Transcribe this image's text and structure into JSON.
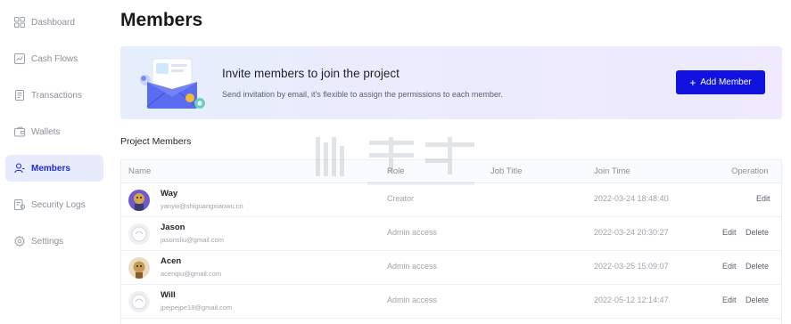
{
  "sidebar": {
    "items": [
      {
        "label": "Dashboard",
        "icon": "dashboard-icon"
      },
      {
        "label": "Cash Flows",
        "icon": "chart-icon"
      },
      {
        "label": "Transactions",
        "icon": "document-icon"
      },
      {
        "label": "Wallets",
        "icon": "wallet-icon"
      },
      {
        "label": "Members",
        "icon": "user-icon",
        "active": true
      },
      {
        "label": "Security Logs",
        "icon": "security-log-icon"
      },
      {
        "label": "Settings",
        "icon": "gear-icon"
      }
    ]
  },
  "page": {
    "title": "Members"
  },
  "banner": {
    "title": "Invite members to join the project",
    "subtitle": "Send invitation by email, it's flexible to assign the permissions to each member.",
    "button_label": "Add Member"
  },
  "section": {
    "title": "Project Members"
  },
  "table": {
    "columns": [
      "Name",
      "Role",
      "Job Title",
      "Join Time",
      "Operation"
    ],
    "rows": [
      {
        "name": "Way",
        "email": "yanyw@shiguangxiaowu.cn",
        "role": "Creator",
        "job_title": "",
        "join_time": "2022-03-24 18:48:40",
        "edit": "Edit",
        "delete": ""
      },
      {
        "name": "Jason",
        "email": "jasonsliu@gmail.com",
        "role": "Admin access",
        "job_title": "",
        "join_time": "2022-03-24 20:30:27",
        "edit": "Edit",
        "delete": "Delete"
      },
      {
        "name": "Acen",
        "email": "acenqiu@gmail.com",
        "role": "Admin access",
        "job_title": "",
        "join_time": "2022-03-25 15:09:07",
        "edit": "Edit",
        "delete": "Delete"
      },
      {
        "name": "Will",
        "email": "jpejpejpe18@gmail.com",
        "role": "Admin access",
        "job_title": "",
        "join_time": "2022-05-12 12:14:47",
        "edit": "Edit",
        "delete": "Delete"
      }
    ]
  },
  "colors": {
    "accent": "#1212e0",
    "active_bg": "#e8ebfb"
  }
}
